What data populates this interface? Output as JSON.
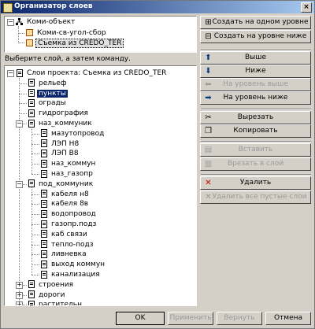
{
  "window": {
    "title": "Организатор слоев",
    "close": "×"
  },
  "objects_tree": {
    "root": "Коми-объект",
    "children": [
      "Коми-св-угол-сбор",
      "Съемка из CREDO_TER"
    ]
  },
  "top_buttons": {
    "create_same_level": "Создать на одном уровне",
    "create_below": "Создать на уровне ниже"
  },
  "instruction": "Выберите слой, а затем команду.",
  "layers_tree": {
    "root": "Слои проекта: Съемка из CREDO_TER",
    "items": [
      {
        "label": "рельеф",
        "level": 1
      },
      {
        "label": "пункты",
        "level": 1,
        "selected": true
      },
      {
        "label": "ограды",
        "level": 1
      },
      {
        "label": "гидрография",
        "level": 1
      },
      {
        "label": "наз_коммуник",
        "level": 1,
        "expanded": true
      },
      {
        "label": "мазутопровод",
        "level": 2
      },
      {
        "label": "ЛЭП Н8",
        "level": 2
      },
      {
        "label": "ЛЭП В8",
        "level": 2
      },
      {
        "label": "наз_коммун",
        "level": 2
      },
      {
        "label": "наз_газопр",
        "level": 2
      },
      {
        "label": "под_коммуник",
        "level": 1,
        "expanded": true
      },
      {
        "label": "кабеля н8",
        "level": 2
      },
      {
        "label": "кабеля 8в",
        "level": 2
      },
      {
        "label": "водопровод",
        "level": 2
      },
      {
        "label": "газопр.подз",
        "level": 2
      },
      {
        "label": "каб связи",
        "level": 2
      },
      {
        "label": "тепло-подз",
        "level": 2
      },
      {
        "label": "ливневка",
        "level": 2
      },
      {
        "label": "выход коммун",
        "level": 2
      },
      {
        "label": "канализация",
        "level": 2
      },
      {
        "label": "строения",
        "level": 1,
        "collapsed": true
      },
      {
        "label": "дороги",
        "level": 1,
        "collapsed": true
      },
      {
        "label": "растительн",
        "level": 1,
        "collapsed": true
      }
    ]
  },
  "side_buttons": {
    "up": "Выше",
    "down": "Ниже",
    "level_up": "На уровень выше",
    "level_down": "На уровень ниже",
    "cut": "Вырезать",
    "copy": "Копировать",
    "paste": "Вставить",
    "cut_into_layer": "Врезать в слой",
    "delete": "Удалить",
    "delete_empty": "Удалить все пустые слои"
  },
  "bottom_buttons": {
    "ok": "OK",
    "apply": "Применить",
    "revert": "Вернуть",
    "cancel": "Отмена"
  },
  "colors": {
    "selection": "#0a246a",
    "title_start": "#0a246a",
    "title_end": "#a6caf0",
    "delete_icon": "#cc0000",
    "arrow_icon": "#003c7a"
  }
}
